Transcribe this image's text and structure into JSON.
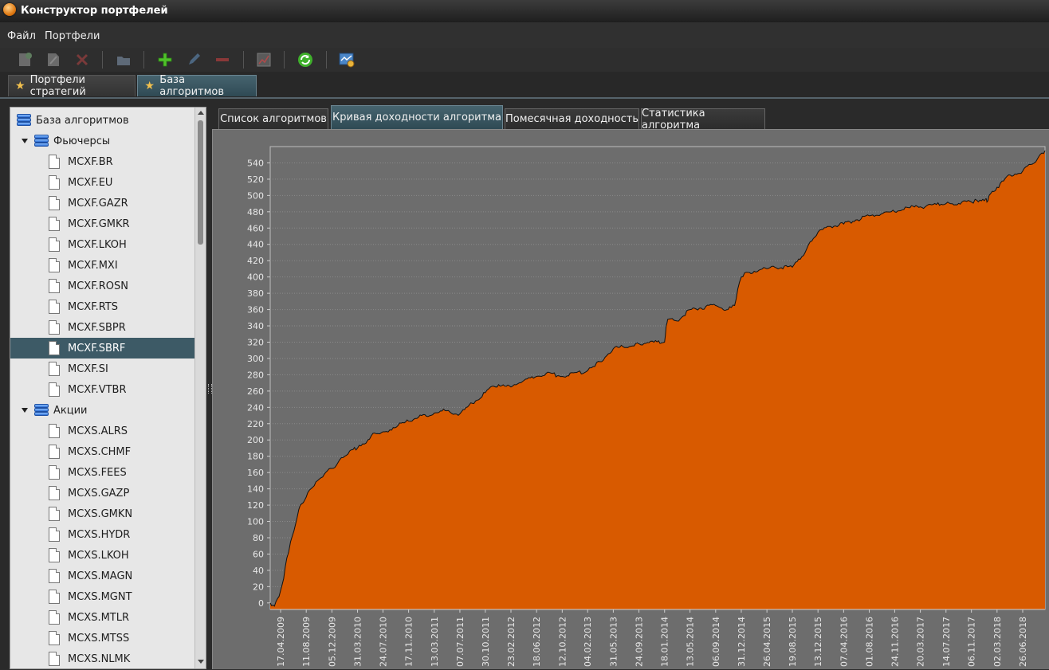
{
  "window": {
    "title": "Конструктор портфелей",
    "icon": "app-orange-circle-icon"
  },
  "menu": [
    {
      "label": "Файл"
    },
    {
      "label": "Портфели"
    }
  ],
  "toolbar": {
    "buttons": [
      {
        "name": "new-portfolio-icon",
        "enabled": false
      },
      {
        "name": "edit-portfolio-icon",
        "enabled": false
      },
      {
        "name": "delete-portfolio-icon",
        "enabled": false
      },
      {
        "name": "folder-icon",
        "enabled": false
      },
      {
        "name": "add-icon",
        "enabled": true
      },
      {
        "name": "pencil-icon",
        "enabled": false
      },
      {
        "name": "remove-icon",
        "enabled": false
      },
      {
        "name": "chart-icon",
        "enabled": false
      },
      {
        "name": "refresh-icon",
        "enabled": true
      },
      {
        "name": "settings-chart-icon",
        "enabled": true
      }
    ]
  },
  "outer_tabs": [
    {
      "label": "Портфели стратегий",
      "active": false
    },
    {
      "label": "База алгоритмов",
      "active": true
    }
  ],
  "tree": {
    "root": "База алгоритмов",
    "groups": [
      {
        "label": "Фьючерсы",
        "expanded": true,
        "items": [
          "MCXF.BR",
          "MCXF.EU",
          "MCXF.GAZR",
          "MCXF.GMKR",
          "MCXF.LKOH",
          "MCXF.MXI",
          "MCXF.ROSN",
          "MCXF.RTS",
          "MCXF.SBPR",
          "MCXF.SBRF",
          "MCXF.SI",
          "MCXF.VTBR"
        ],
        "selected": "MCXF.SBRF"
      },
      {
        "label": "Акции",
        "expanded": true,
        "items": [
          "MCXS.ALRS",
          "MCXS.CHMF",
          "MCXS.FEES",
          "MCXS.GAZP",
          "MCXS.GMKN",
          "MCXS.HYDR",
          "MCXS.LKOH",
          "MCXS.MAGN",
          "MCXS.MGNT",
          "MCXS.MTLR",
          "MCXS.MTSS",
          "MCXS.NLMK"
        ]
      }
    ]
  },
  "inner_tabs": [
    {
      "label": "Список алгоритмов",
      "active": false
    },
    {
      "label": "Кривая доходности алгоритма",
      "active": true
    },
    {
      "label": "Помесячная доходность",
      "active": false
    },
    {
      "label": "Статистика алгоритма",
      "active": false
    }
  ],
  "chart_data": {
    "type": "area",
    "title": "",
    "xlabel": "",
    "ylabel": "",
    "ylim": [
      -8,
      560
    ],
    "yticks": [
      0,
      20,
      40,
      60,
      80,
      100,
      120,
      140,
      160,
      180,
      200,
      220,
      240,
      260,
      280,
      300,
      320,
      340,
      360,
      380,
      400,
      420,
      440,
      460,
      480,
      500,
      520,
      540
    ],
    "grid": true,
    "colors": {
      "fill": "#d85a00",
      "line": "#111111",
      "background": "#6d6d6d",
      "grid": "#8a8a8a"
    },
    "xticks": [
      "17.04.2009",
      "11.08.2009",
      "05.12.2009",
      "31.03.2010",
      "24.07.2010",
      "17.11.2010",
      "13.03.2011",
      "07.07.2011",
      "30.10.2011",
      "23.02.2012",
      "18.06.2012",
      "12.10.2012",
      "04.02.2013",
      "31.05.2013",
      "24.09.2013",
      "18.01.2014",
      "13.05.2014",
      "06.09.2014",
      "31.12.2014",
      "26.04.2015",
      "19.08.2015",
      "13.12.2015",
      "07.04.2016",
      "01.08.2016",
      "24.11.2016",
      "20.03.2017",
      "14.07.2017",
      "06.11.2017",
      "02.03.2018",
      "26.06.2018"
    ],
    "x_start": "01.03.2009",
    "x_end": "05.10.2018",
    "series": [
      {
        "x": [
          "01.03.2009",
          "20.03.2009",
          "10.04.2009",
          "01.05.2009",
          "15.05.2009",
          "01.06.2009",
          "01.07.2009",
          "15.07.2009",
          "11.08.2009",
          "01.09.2009",
          "01.10.2009",
          "01.11.2009",
          "05.12.2009",
          "01.01.2010",
          "01.02.2010",
          "10.03.2010",
          "31.03.2010",
          "01.05.2010",
          "01.06.2010",
          "24.07.2010",
          "01.09.2010",
          "01.10.2010",
          "17.11.2010",
          "01.01.2011",
          "13.03.2011",
          "01.05.2011",
          "07.07.2011",
          "01.09.2011",
          "30.10.2011",
          "01.12.2011",
          "23.02.2012",
          "01.04.2012",
          "18.06.2012",
          "01.08.2012",
          "12.10.2012",
          "04.02.2013",
          "01.03.2013",
          "01.04.2013",
          "31.05.2013",
          "24.09.2013",
          "01.12.2013",
          "18.01.2014",
          "25.01.2014",
          "01.02.2014",
          "15.03.2014",
          "13.05.2014",
          "01.07.2014",
          "06.09.2014",
          "01.11.2014",
          "01.12.2014",
          "15.12.2014",
          "31.12.2014",
          "15.01.2015",
          "26.04.2015",
          "01.06.2015",
          "19.08.2015",
          "01.10.2015",
          "01.11.2015",
          "13.12.2015",
          "01.02.2016",
          "07.04.2016",
          "01.06.2016",
          "01.08.2016",
          "01.10.2016",
          "24.11.2016",
          "01.02.2017",
          "20.03.2017",
          "14.07.2017",
          "06.11.2017",
          "01.12.2017",
          "10.01.2018",
          "15.01.2018",
          "25.01.2018",
          "02.03.2018",
          "01.05.2018",
          "26.06.2018",
          "01.08.2018",
          "01.09.2018",
          "05.10.2018"
        ],
        "y": [
          0,
          -4,
          8,
          30,
          55,
          75,
          105,
          120,
          130,
          140,
          150,
          158,
          165,
          172,
          180,
          188,
          190,
          195,
          205,
          210,
          212,
          218,
          223,
          228,
          233,
          236,
          232,
          245,
          258,
          266,
          265,
          270,
          278,
          282,
          278,
          285,
          290,
          296,
          312,
          318,
          320,
          320,
          340,
          348,
          346,
          360,
          362,
          365,
          360,
          365,
          385,
          400,
          405,
          410,
          412,
          412,
          425,
          440,
          455,
          462,
          465,
          470,
          475,
          478,
          480,
          485,
          486,
          490,
          492,
          494,
          496,
          492,
          500,
          510,
          525,
          530,
          538,
          545,
          555
        ]
      }
    ]
  }
}
